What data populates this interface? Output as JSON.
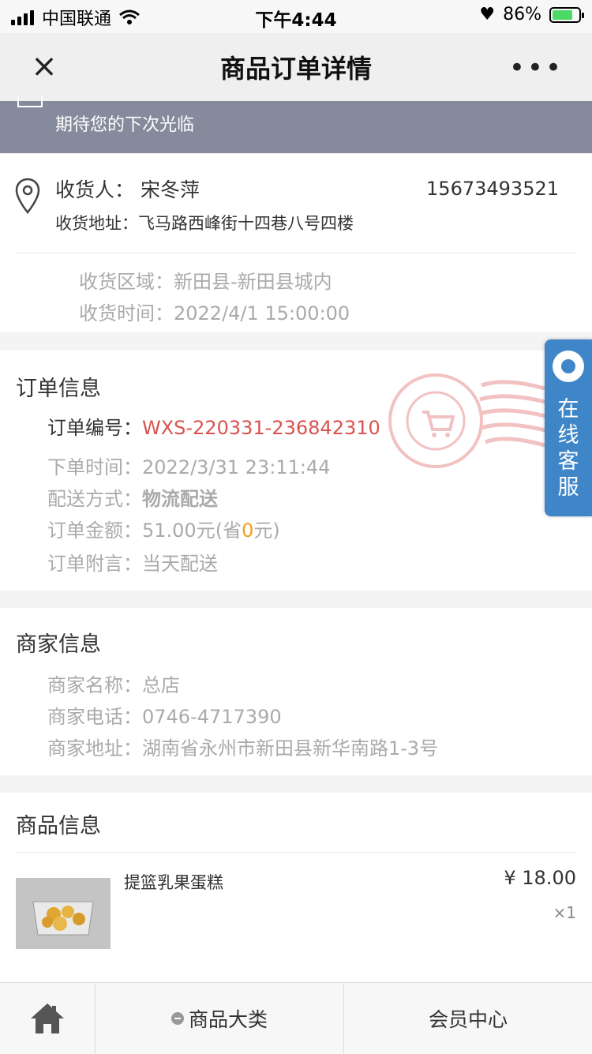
{
  "status_bar": {
    "carrier": "中国联通",
    "time": "下午4:44",
    "battery": "86%"
  },
  "nav": {
    "title": "商品订单详情",
    "close_icon": "×",
    "more_icon": "•••"
  },
  "banner": {
    "text": "期待您的下次光临"
  },
  "address": {
    "recipient_label": "收货人：",
    "recipient_name": "宋冬萍",
    "phone": "15673493521",
    "address": "收货地址：飞马路西峰街十四巷八号四楼",
    "area": "收货区域：新田县-新田县城内",
    "time": "收货时间：2022/4/1 15:00:00"
  },
  "order": {
    "title": "订单信息",
    "number_label": "订单编号：",
    "number": "WXS-220331-236842310",
    "order_time": "下单时间：2022/3/31 23:11:44",
    "delivery_label": "配送方式：",
    "delivery": "物流配送",
    "amount_prefix": "订单金额：51.00元(省",
    "amount_saved": "0",
    "amount_suffix": "元)",
    "note": "订单附言：当天配送"
  },
  "merchant": {
    "title": "商家信息",
    "name": "商家名称：总店",
    "phone": "商家电话：0746-4717390",
    "address": "商家地址：湖南省永州市新田县新华南路1-3号"
  },
  "goods": {
    "title": "商品信息",
    "items": [
      {
        "name": "提篮乳果蛋糕",
        "price": "¥ 18.00",
        "qty": "×1"
      }
    ]
  },
  "kefu": {
    "label": "在线客服"
  },
  "tabbar": {
    "home_icon": "home-icon",
    "category": "商品大类",
    "member": "会员中心"
  },
  "colors": {
    "accent_red": "#d9534f",
    "banner": "#858a9c",
    "kefu_blue": "#3f86c8",
    "saved_orange": "#f0a020"
  }
}
